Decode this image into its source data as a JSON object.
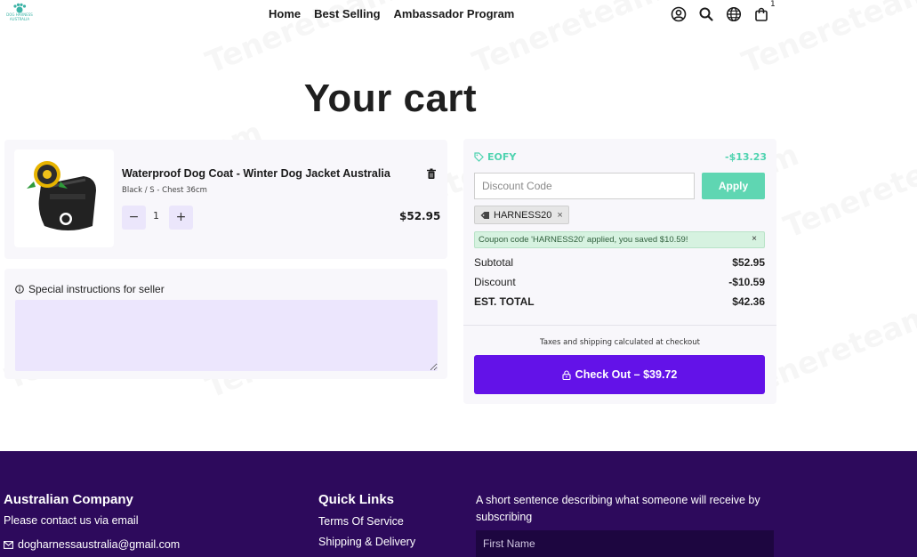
{
  "logo": {
    "text": "DOG HARNESS AUSTRALIA"
  },
  "nav": {
    "items": [
      {
        "label": "Home"
      },
      {
        "label": "Best Selling"
      },
      {
        "label": "Ambassador Program"
      }
    ]
  },
  "header": {
    "icons": [
      "account-icon",
      "search-icon",
      "globe-icon",
      "cart-bag-icon"
    ],
    "cart_count": "1"
  },
  "watermark": "Tenereteam",
  "page_title": "Your cart",
  "cart_item": {
    "title": "Waterproof Dog Coat - Winter Dog Jacket Australia",
    "variant": "Black / S - Chest 36cm",
    "quantity": "1",
    "minus_label": "−",
    "plus_label": "+",
    "price": "$52.95"
  },
  "instructions": {
    "label": "Special instructions for seller"
  },
  "summary": {
    "promo_code": "EOFY",
    "promo_amount": "-$13.23",
    "discount_placeholder": "Discount Code",
    "apply_label": "Apply",
    "applied_coupon": "HARNESS20",
    "coupon_message": "Coupon code 'HARNESS20' applied, you saved $10.59!",
    "subtotal_label": "Subtotal",
    "subtotal_value": "$52.95",
    "discount_label": "Discount",
    "discount_value": "-$10.59",
    "total_label": "EST. TOTAL",
    "total_value": "$42.36",
    "tax_note": "Taxes and shipping calculated at checkout",
    "checkout_label": "Check Out – $39.72"
  },
  "footer": {
    "company_heading": "Australian Company",
    "company_text": "Please contact us via email",
    "email": "dogharnessaustralia@gmail.com",
    "links_heading": "Quick Links",
    "links": [
      "Terms Of Service",
      "Shipping & Delivery"
    ],
    "newsletter_desc": "A short sentence describing what someone will receive by subscribing",
    "first_name_placeholder": "First Name"
  },
  "colors": {
    "brand_purple": "#6312e8",
    "promo_green": "#4fd3b0",
    "apply_green": "#5fd6b2",
    "footer_bg": "#2d0a5c"
  }
}
